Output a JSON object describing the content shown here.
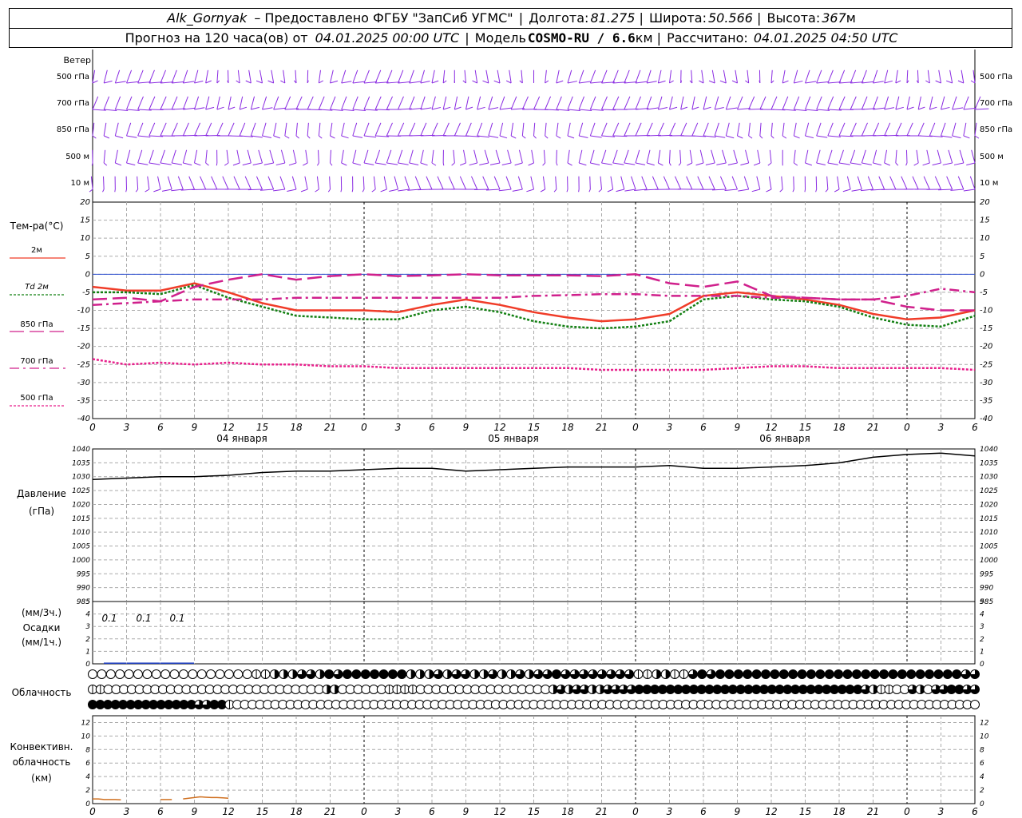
{
  "header": {
    "station": "Alk_Gornyak",
    "provider_prefix": "–  Предоставлено ФГБУ \"ЗапСиб УГМС\"",
    "lon_label": "Долгота:",
    "lon_value": "81.275",
    "lat_label": "Широта:",
    "lat_value": "50.566",
    "alt_label": "Высота:",
    "alt_value": "367",
    "alt_unit": "м",
    "forecast_prefix": "Прогноз на 120 часа(ов) от",
    "forecast_start": "04.01.2025 00:00 UTC",
    "model_label": "Модель",
    "model_name": "COSMO-RU / 6.6",
    "model_unit": "км",
    "computed_label": "Рассчитано:",
    "computed_value": "04.01.2025 04:50 UTC"
  },
  "labels": {
    "wind": "Ветер",
    "wind_levels": [
      "500 гПа",
      "700 гПа",
      "850 гПа",
      "500 м",
      "10 м"
    ],
    "temperature": "Тем-ра(°С)",
    "pressure_1": "Давление",
    "pressure_2": "(гПа)",
    "precip_1": "(мм/3ч.)",
    "precip_2": "Осадки",
    "precip_3": "(мм/1ч.)",
    "cloudiness": "Облачность",
    "conv_1": "Конвективн.",
    "conv_2": "облачность",
    "conv_3": "(км)",
    "dates": [
      "04 января",
      "05 января",
      "06 января"
    ]
  },
  "colors": {
    "wind": "#8a2be2",
    "t2m": "#f03c28",
    "td2m": "#138013",
    "t850": "#d0208c",
    "t700": "#d0208c",
    "t500": "#e8208c",
    "zero_line": "#3050d0",
    "precip": "#2040c0",
    "conv": "#d07020"
  },
  "chart_data": [
    {
      "type": "line",
      "title": "Тем-ра(°С)",
      "hour_ticks": [
        "0",
        "3",
        "6",
        "9",
        "12",
        "15",
        "18",
        "21",
        "0",
        "3",
        "6",
        "9",
        "12",
        "15",
        "18",
        "21",
        "0",
        "3",
        "6",
        "9",
        "12",
        "15",
        "18",
        "21",
        "0",
        "3",
        "6"
      ],
      "ylim": [
        -40,
        20
      ],
      "yticks": [
        20,
        15,
        10,
        5,
        0,
        -5,
        -10,
        -15,
        -20,
        -25,
        -30,
        -35,
        -40
      ],
      "x_hours": [
        0,
        3,
        6,
        9,
        12,
        15,
        18,
        21,
        24,
        27,
        30,
        33,
        36,
        39,
        42,
        45,
        48,
        51,
        54,
        57,
        60,
        63,
        66,
        69,
        72,
        75,
        78
      ],
      "series": [
        {
          "name": "2м",
          "values": [
            -3.5,
            -4.5,
            -4.5,
            -2.5,
            -5,
            -8,
            -10,
            -10,
            -10,
            -10.5,
            -8.5,
            -7,
            -8.5,
            -10.5,
            -12,
            -13,
            -12.5,
            -11,
            -6,
            -5,
            -6,
            -7,
            -8.5,
            -11,
            -12.5,
            -12,
            -10
          ]
        },
        {
          "name": "Td 2м",
          "values": [
            -5,
            -5,
            -5.5,
            -3,
            -6.5,
            -9,
            -11.5,
            -12,
            -12.5,
            -12.5,
            -10,
            -9,
            -10.5,
            -13,
            -14.5,
            -15,
            -14.5,
            -13,
            -7,
            -6,
            -7,
            -7.5,
            -9,
            -12,
            -14,
            -14.5,
            -11.5
          ]
        },
        {
          "name": "850 гПа",
          "values": [
            -7,
            -6.5,
            -7.5,
            -3.5,
            -1.5,
            0,
            -1.5,
            -0.5,
            0,
            -0.5,
            -0.3,
            0,
            -0.3,
            -0.3,
            -0.3,
            -0.5,
            0,
            -2.5,
            -3.5,
            -2,
            -6,
            -6.5,
            -7,
            -7,
            -9,
            -10,
            -10
          ]
        },
        {
          "name": "700 гПа",
          "values": [
            -8.5,
            -8,
            -7.5,
            -7,
            -7,
            -7,
            -6.5,
            -6.5,
            -6.5,
            -6.5,
            -6.5,
            -6.5,
            -6.5,
            -6,
            -5.8,
            -5.5,
            -5.5,
            -6,
            -6,
            -6,
            -6.5,
            -6.5,
            -7,
            -7,
            -6,
            -4,
            -5
          ]
        },
        {
          "name": "500 гПа",
          "values": [
            -23.5,
            -25,
            -24.5,
            -25,
            -24.5,
            -25,
            -25,
            -25.5,
            -25.5,
            -26,
            -26,
            -26,
            -26,
            -26,
            -26,
            -26.5,
            -26.5,
            -26.5,
            -26.5,
            -26,
            -25.5,
            -25.5,
            -26,
            -26,
            -26,
            -26,
            -26.5
          ]
        }
      ]
    },
    {
      "type": "line",
      "title": "Давление (гПа)",
      "ylim": [
        985,
        1040
      ],
      "yticks": [
        1040,
        1035,
        1030,
        1025,
        1020,
        1015,
        1010,
        1005,
        1000,
        995,
        990,
        985
      ],
      "x_hours": [
        0,
        3,
        6,
        9,
        12,
        15,
        18,
        21,
        24,
        27,
        30,
        33,
        36,
        39,
        42,
        45,
        48,
        51,
        54,
        57,
        60,
        63,
        66,
        69,
        72,
        75,
        78
      ],
      "series": [
        {
          "name": "Давление",
          "values": [
            1029,
            1029.5,
            1030,
            1030,
            1030.5,
            1031.5,
            1032,
            1032,
            1032.5,
            1033,
            1033,
            1032,
            1032.5,
            1033,
            1033.5,
            1033.5,
            1033.5,
            1034,
            1033,
            1033,
            1033.5,
            1034,
            1035,
            1037,
            1038,
            1038.5,
            1037.5
          ]
        }
      ]
    },
    {
      "type": "bar",
      "title": "Осадки",
      "ylim": [
        0,
        5
      ],
      "yticks": [
        5,
        4,
        3,
        2,
        1,
        0
      ],
      "annotations": [
        "0.1",
        "0.1",
        "0.1"
      ],
      "x_hours": [
        0,
        3,
        6
      ],
      "series": [
        {
          "name": "Осадки",
          "values": [
            0.1,
            0.1,
            0.1
          ]
        }
      ]
    },
    {
      "type": "line",
      "title": "Конвективн. облачность (км)",
      "ylim": [
        0,
        13
      ],
      "yticks": [
        12,
        10,
        8,
        6,
        4,
        2,
        0
      ],
      "series": [
        {
          "name": "Конвективная облачность",
          "x_hours": [
            0,
            0.5,
            1,
            1.5,
            2,
            2.5
          ],
          "values": [
            0.7,
            0.7,
            0.6,
            0.6,
            0.6,
            0.55
          ]
        },
        {
          "name": "Конвективная облачность",
          "x_hours": [
            6,
            6.5,
            7
          ],
          "values": [
            0.6,
            0.6,
            0.6
          ]
        },
        {
          "name": "Конвективная облачность",
          "x_hours": [
            8,
            8.5,
            9,
            9.5,
            10,
            10.5,
            11,
            11.5,
            12
          ],
          "values": [
            0.7,
            0.8,
            0.9,
            1,
            0.95,
            0.9,
            0.9,
            0.85,
            0.8
          ]
        }
      ]
    }
  ],
  "clouds": {
    "upper": [
      0,
      0,
      0,
      0,
      0,
      0,
      0,
      0,
      0,
      0,
      0,
      0,
      0,
      0,
      0,
      0,
      0,
      0,
      1,
      1,
      2,
      2,
      2,
      3,
      3,
      2,
      4,
      3,
      4,
      4,
      4,
      4,
      4,
      4,
      4,
      2,
      2,
      2,
      3,
      2,
      3,
      3,
      2,
      2,
      3,
      2,
      2,
      3,
      2,
      3,
      3,
      4,
      3,
      3,
      3,
      3,
      3,
      3,
      3,
      3,
      1,
      1,
      2,
      2,
      1,
      1,
      3,
      4,
      3,
      4,
      4,
      4,
      4,
      4,
      4,
      4,
      4,
      4,
      4,
      4,
      4,
      4,
      4,
      4,
      4,
      4,
      4,
      4,
      4,
      4,
      4,
      4,
      4,
      4,
      4,
      4,
      3,
      3
    ],
    "middle": [
      1,
      1,
      0,
      0,
      0,
      0,
      0,
      0,
      0,
      0,
      0,
      0,
      0,
      0,
      0,
      0,
      0,
      0,
      0,
      0,
      0,
      0,
      0,
      0,
      0,
      0,
      0,
      0,
      0,
      0,
      2,
      2,
      0,
      0,
      0,
      0,
      0,
      0,
      1,
      1,
      1,
      1,
      0,
      0,
      0,
      0,
      0,
      0,
      0,
      0,
      0,
      0,
      0,
      0,
      0,
      0,
      0,
      0,
      0,
      2,
      3,
      2,
      3,
      3,
      2,
      2,
      3,
      3,
      3,
      3,
      4,
      4,
      4,
      4,
      4,
      4,
      4,
      4,
      4,
      4,
      4,
      4,
      4,
      4,
      4,
      4,
      4,
      4,
      4,
      4,
      4,
      4,
      4,
      4,
      4,
      4,
      4,
      4,
      4,
      3,
      2,
      1,
      1,
      0,
      0,
      3,
      2,
      0,
      3,
      3,
      4,
      4,
      3,
      3
    ],
    "lower": [
      4,
      4,
      4,
      4,
      4,
      4,
      4,
      4,
      4,
      4,
      4,
      4,
      4,
      4,
      3,
      3,
      4,
      4,
      1,
      0,
      0,
      0,
      0,
      0,
      0,
      0,
      0,
      0,
      0,
      0,
      0,
      0,
      0,
      0,
      0,
      0,
      0,
      0,
      0,
      0,
      0,
      0,
      0,
      0,
      0,
      0,
      0,
      0,
      0,
      0,
      0,
      0,
      0,
      0,
      0,
      0,
      0,
      0,
      0,
      0,
      0,
      0,
      0,
      0,
      0,
      0,
      0,
      0,
      0,
      0,
      0,
      0,
      0,
      0,
      0,
      0,
      0,
      0,
      0,
      0,
      0,
      0,
      0,
      0,
      0,
      0,
      0,
      0,
      0,
      0,
      0,
      0,
      0,
      0,
      0,
      0,
      0,
      0,
      0,
      0,
      0,
      0,
      0,
      0,
      0,
      0,
      0,
      0,
      0,
      0,
      0,
      0,
      0,
      0,
      0,
      0,
      0
    ]
  }
}
